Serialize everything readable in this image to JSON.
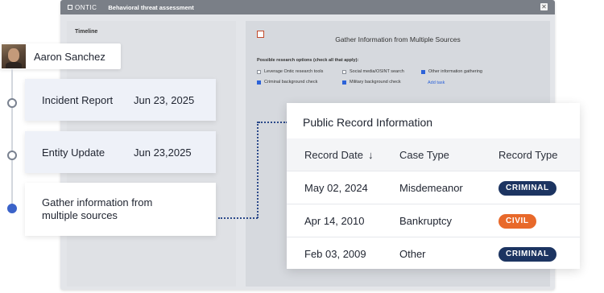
{
  "app": {
    "brand": "ONTIC",
    "title": "Behavioral threat assessment",
    "close_glyph": "✕"
  },
  "left_pane": {
    "heading": "Timeline"
  },
  "task": {
    "title": "Gather Information from Multiple Sources",
    "options_label": "Possible research options (check all that apply):",
    "options": [
      {
        "label": "Leverage Ontic research tools",
        "checked": false
      },
      {
        "label": "Social media/OSINT search",
        "checked": false
      },
      {
        "label": "Other information gathering",
        "checked": true
      },
      {
        "label": "Criminal background check",
        "checked": true
      },
      {
        "label": "Military background check",
        "checked": true
      }
    ],
    "add_task": "Add task"
  },
  "user": {
    "name": "Aaron Sanchez"
  },
  "timeline": [
    {
      "title": "Incident Report",
      "date": "Jun 23, 2025"
    },
    {
      "title": "Entity Update",
      "date": "Jun 23,2025"
    },
    {
      "title": "Gather information from multiple sources",
      "date": ""
    }
  ],
  "records": {
    "title": "Public Record Information",
    "headers": [
      "Record Date",
      "Case Type",
      "Record Type"
    ],
    "sort_icon": "arrow-down-icon",
    "rows": [
      {
        "date": "May 02, 2024",
        "case": "Misdemeanor",
        "type": "CRIMINAL",
        "color": "#1c3461"
      },
      {
        "date": "Apr 14, 2010",
        "case": "Bankruptcy",
        "type": "CIVIL",
        "color": "#e8692a"
      },
      {
        "date": "Feb 03, 2009",
        "case": "Other",
        "type": "CRIMINAL",
        "color": "#1c3461"
      }
    ]
  }
}
